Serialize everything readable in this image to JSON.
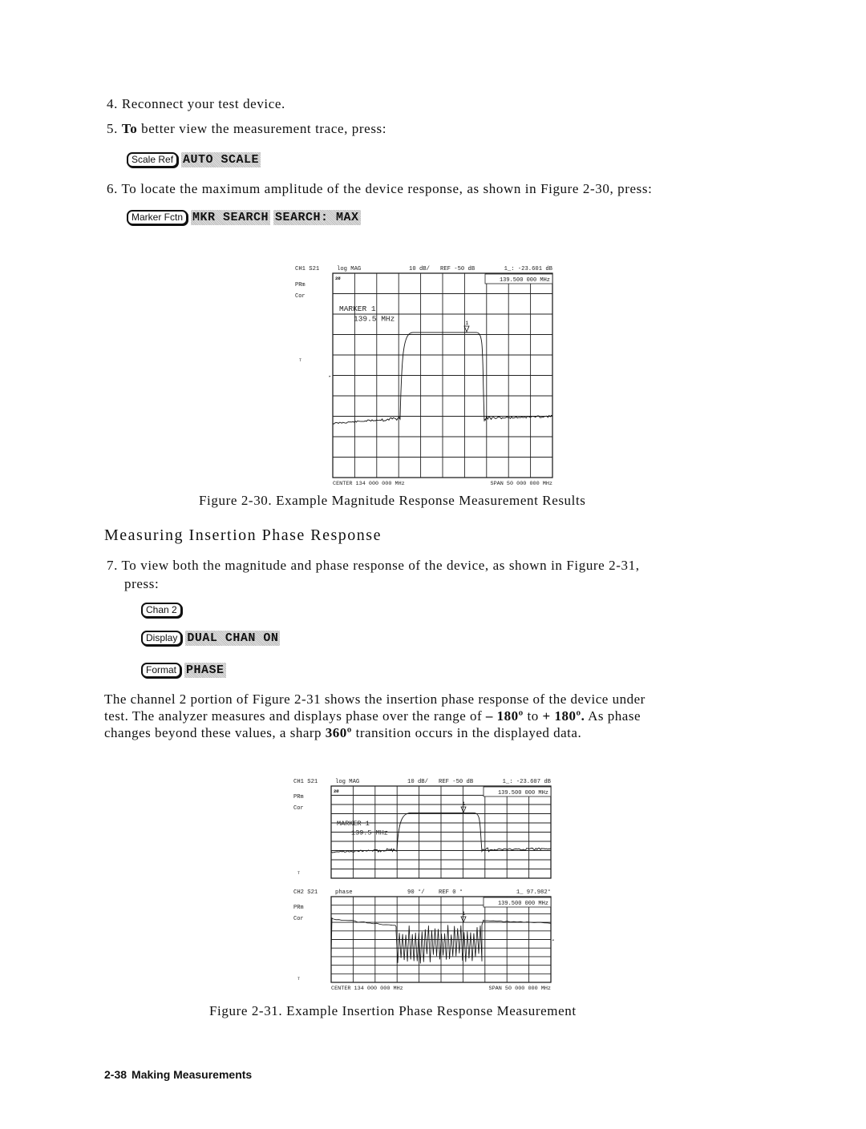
{
  "steps": {
    "step4": {
      "number": "4.",
      "text": "Reconnect your test device."
    },
    "step5": {
      "number": "5.",
      "bold_lead": "To",
      "text": " better view the measurement trace, press:",
      "keys": [
        {
          "type": "hardkey",
          "label": "Scale Ref"
        },
        {
          "type": "softkey",
          "label": "AUTO SCALE"
        }
      ]
    },
    "step6": {
      "number": "6.",
      "text": "To locate the maximum amplitude of the device response, as shown in Figure 2-30, press:",
      "keys": [
        {
          "type": "hardkey",
          "label": "Marker Fctn"
        },
        {
          "type": "softkey",
          "label": "MKR SEARCH"
        },
        {
          "type": "softkey",
          "label": "SEARCH: MAX"
        }
      ]
    },
    "step7": {
      "number": "7.",
      "text": "To view both the magnitude and phase response of the device, as shown in Figure 2-31,",
      "text2": "press:",
      "key_rows": [
        [
          {
            "type": "hardkey",
            "label": "Chan 2"
          }
        ],
        [
          {
            "type": "hardkey",
            "label": "Display"
          },
          {
            "type": "softkey",
            "label": "DUAL CHAN ON"
          }
        ],
        [
          {
            "type": "hardkey",
            "label": "Format"
          },
          {
            "type": "softkey",
            "label": "PHASE"
          }
        ]
      ]
    }
  },
  "section_heading": "Measuring Insertion Phase Response",
  "paragraph": {
    "line1": "The channel 2 portion of Figure 2-31 shows the insertion phase response of the device under",
    "line2_a": "test. The analyzer measures and displays phase over the range of ",
    "line2_b1": "– 180º",
    "line2_c": " to ",
    "line2_b2": "+ 180º.",
    "line2_d": " As phase",
    "line3_a": "changes beyond these values, a sharp ",
    "line3_b": "360º",
    "line3_c": " transition occurs in the displayed data."
  },
  "figures": {
    "fig30": {
      "caption": "Figure 2-30. Example Magnitude Response Measurement Results",
      "ch1": {
        "channel": "CH1",
        "param": "S21",
        "format": "log MAG",
        "scale": "10 dB/",
        "ref": "REF -50 dB",
        "marker_readout": "1_: -23.601 dB",
        "marker_freq": "139.500 000 MHz",
        "side_labels": [
          "PRm",
          "Cor"
        ],
        "marker_label": "MARKER 1",
        "marker_value": "139.5 MHz"
      },
      "footer": {
        "center": "CENTER  134 000 000 MHz",
        "span": "SPAN   50 000 000 MHz"
      }
    },
    "fig31": {
      "caption": "Figure 2-31. Example Insertion Phase Response Measurement",
      "ch1": {
        "channel": "CH1",
        "param": "S21",
        "format": "log MAG",
        "scale": "10 dB/",
        "ref": "REF -50 dB",
        "marker_readout": "1_: -23.607 dB",
        "marker_freq": "139.500 000 MHz",
        "side_labels": [
          "PRm",
          "Cor"
        ],
        "marker_label": "MARKER 1",
        "marker_value": "139.5 MHz"
      },
      "ch2": {
        "channel": "CH2",
        "param": "S21",
        "format": "phase",
        "scale": "90 °/",
        "ref": "REF 0 °",
        "marker_readout": "1_  97.982°",
        "marker_freq": "139.500 000 MHz",
        "side_labels": [
          "PRm",
          "Cor"
        ]
      },
      "footer": {
        "center": "CENTER  134 000 000 MHz",
        "span": "SPAN   50 000 000 MHz"
      }
    }
  },
  "footer": {
    "page": "2-38",
    "title": "Making Measurements"
  }
}
